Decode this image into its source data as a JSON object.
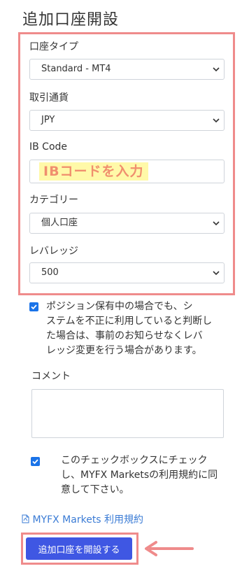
{
  "page_title": "追加口座開設",
  "form": {
    "account_type": {
      "label": "口座タイプ",
      "value": "Standard - MT4"
    },
    "currency": {
      "label": "取引通貨",
      "value": "JPY"
    },
    "ib_code": {
      "label": "IB Code",
      "value": "",
      "annotation": "IBコードを入力"
    },
    "category": {
      "label": "カテゴリー",
      "value": "個人口座"
    },
    "leverage": {
      "label": "レバレッジ",
      "value": "500"
    }
  },
  "leverage_notice": {
    "checked": true,
    "lines": [
      "ポジション保有中の場合でも、シ",
      "ステムを不正に利用していると判断し",
      "た場合は、事前のお知らせなくレバ",
      "レッジ変更を行う場合があります。"
    ]
  },
  "comment": {
    "label": "コメント",
    "value": ""
  },
  "terms_agree": {
    "checked": true,
    "lines": [
      "このチェックボックスにチェック",
      "し、MYFX Marketsの利用規約に同",
      "意して下さい。"
    ]
  },
  "terms_link": {
    "label": "MYFX Markets 利用規約"
  },
  "submit_button": {
    "label": "追加口座を開設する"
  },
  "colors": {
    "accent": "#3f57e3",
    "highlight_border": "#ef8b8b",
    "checkbox": "#1a73e8",
    "link": "#3a7bd5"
  }
}
